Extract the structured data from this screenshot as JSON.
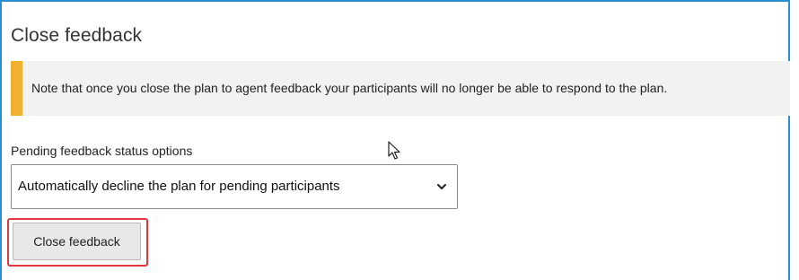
{
  "header": {
    "title": "Close feedback"
  },
  "note": {
    "text": "Note that once you close the plan to agent feedback your participants will no longer be able to respond to the plan.",
    "accent_color": "#f0b030"
  },
  "status_field": {
    "label": "Pending feedback status options",
    "selected_value": "Automatically decline the plan for pending participants"
  },
  "actions": {
    "close_label": "Close feedback",
    "highlight_color": "#e0383e"
  },
  "icons": {
    "dropdown": "chevron-down-icon",
    "pointer": "mouse-cursor-icon"
  },
  "colors": {
    "frame_border": "#2a8fd0"
  }
}
